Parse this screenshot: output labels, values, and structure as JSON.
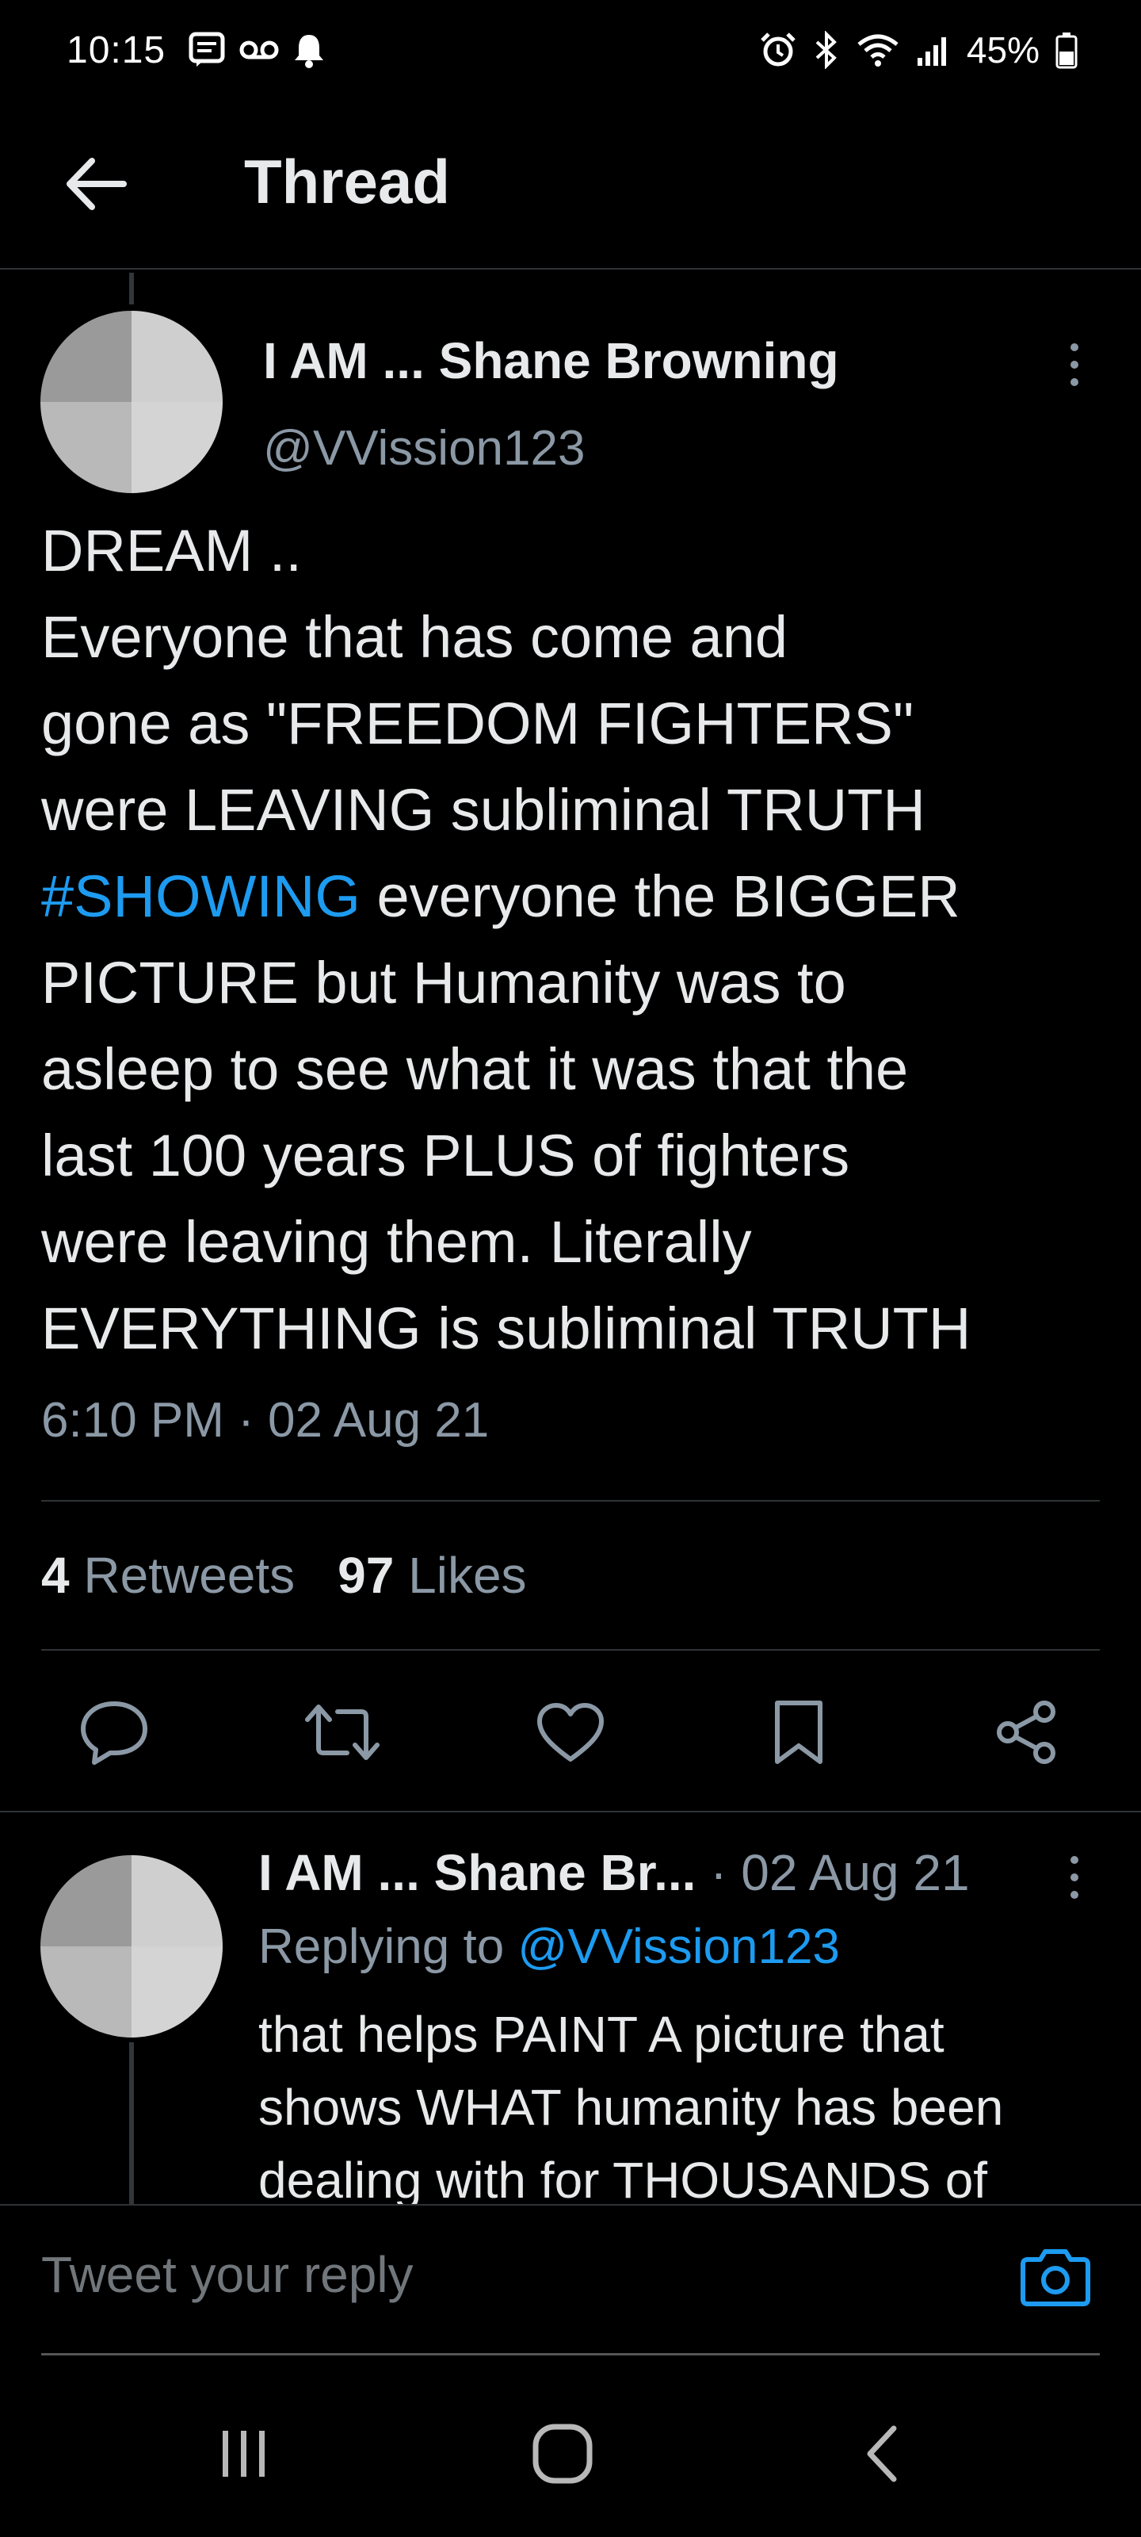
{
  "status_bar": {
    "time": "10:15",
    "battery": "45%",
    "left_icons": [
      "message-icon",
      "voicemail-icon",
      "notification-bell-icon"
    ],
    "right_icons": [
      "alarm-icon",
      "bluetooth-icon",
      "wifi-icon",
      "signal-icon",
      "battery-icon"
    ]
  },
  "header": {
    "title": "Thread"
  },
  "main_tweet": {
    "author_name": "I AM ... Shane Browning",
    "author_handle": "@VVission123",
    "body_lines": [
      "DREAM ..",
      "Everyone that has come and",
      "gone as \"FREEDOM FIGHTERS\"",
      "were LEAVING subliminal TRUTH",
      "everyone the BIGGER",
      "PICTURE but Humanity was to",
      "asleep to see what it was that the",
      "last 100 years PLUS of fighters",
      "were leaving them. Literally",
      "EVERYTHING is subliminal TRUTH"
    ],
    "hashtag": "#SHOWING",
    "timestamp": "6:10 PM · 02 Aug 21",
    "retweets_count": "4",
    "retweets_label": "Retweets",
    "likes_count": "97",
    "likes_label": "Likes"
  },
  "reply": {
    "author_name": "I AM ... Shane Br...",
    "date": "· 02 Aug 21",
    "replying_prefix": "Replying to",
    "replying_handle": "@VVission123",
    "body_lines": [
      "that helps PAINT A picture that",
      "shows WHAT humanity has been",
      "dealing with for THOUSANDS of"
    ]
  },
  "composer": {
    "placeholder": "Tweet your reply"
  },
  "colors": {
    "background": "#000000",
    "link": "#1d9bf0",
    "secondary_text": "#8b98a5",
    "divider": "#2f3336"
  }
}
